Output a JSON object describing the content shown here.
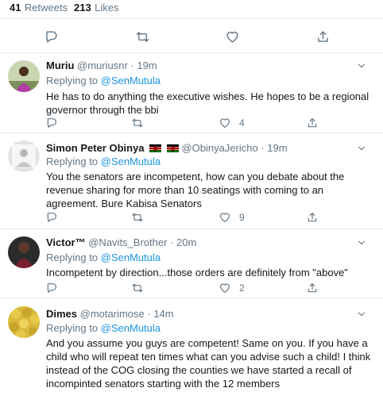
{
  "stats": {
    "retweets_count": "41",
    "retweets_label": "Retweets",
    "likes_count": "213",
    "likes_label": "Likes"
  },
  "icons": [
    "reply-icon",
    "retweet-icon",
    "like-icon",
    "share-icon",
    "chevron-down-icon",
    "kenya-flag-icon"
  ],
  "colors": {
    "link": "#1b95e0",
    "muted": "#657786",
    "text": "#14171a",
    "divider": "#e6ecf0"
  },
  "replies": [
    {
      "name": "Muriu",
      "handle": "@muriusnr",
      "time": "· 19m",
      "replying_prefix": "Replying to",
      "replying_to": "@SenMutula",
      "text": "He has to do anything the executive wishes. He hopes to be a regional governor through the bbi",
      "likes": "4"
    },
    {
      "name": "Simon Peter Obinya",
      "handle": "@ObinyaJericho",
      "time": "· 19m",
      "replying_prefix": "Replying to",
      "replying_to": "@SenMutula",
      "text": "You the senators are incompetent, how can you debate about the revenue sharing for more than 10 seatings with coming to an agreement. Bure Kabisa Senators",
      "likes": "9"
    },
    {
      "name": "Victor™",
      "handle": "@Navits_Brother",
      "time": "· 20m",
      "replying_prefix": "Replying to",
      "replying_to": "@SenMutula",
      "text": "Incompetent by direction...those orders are definitely from \"above\"",
      "likes": "2"
    },
    {
      "name": "Dimes",
      "handle": "@motarimose",
      "time": "· 14m",
      "replying_prefix": "Replying to",
      "replying_to": "@SenMutula",
      "text": "And you assume you guys are competent! Same on you. If you have a child who will repeat ten times what can you advise such a child! I think instead of the COG closing the counties we have started a recall of incompinted senators starting with the 12 members",
      "likes": ""
    }
  ]
}
